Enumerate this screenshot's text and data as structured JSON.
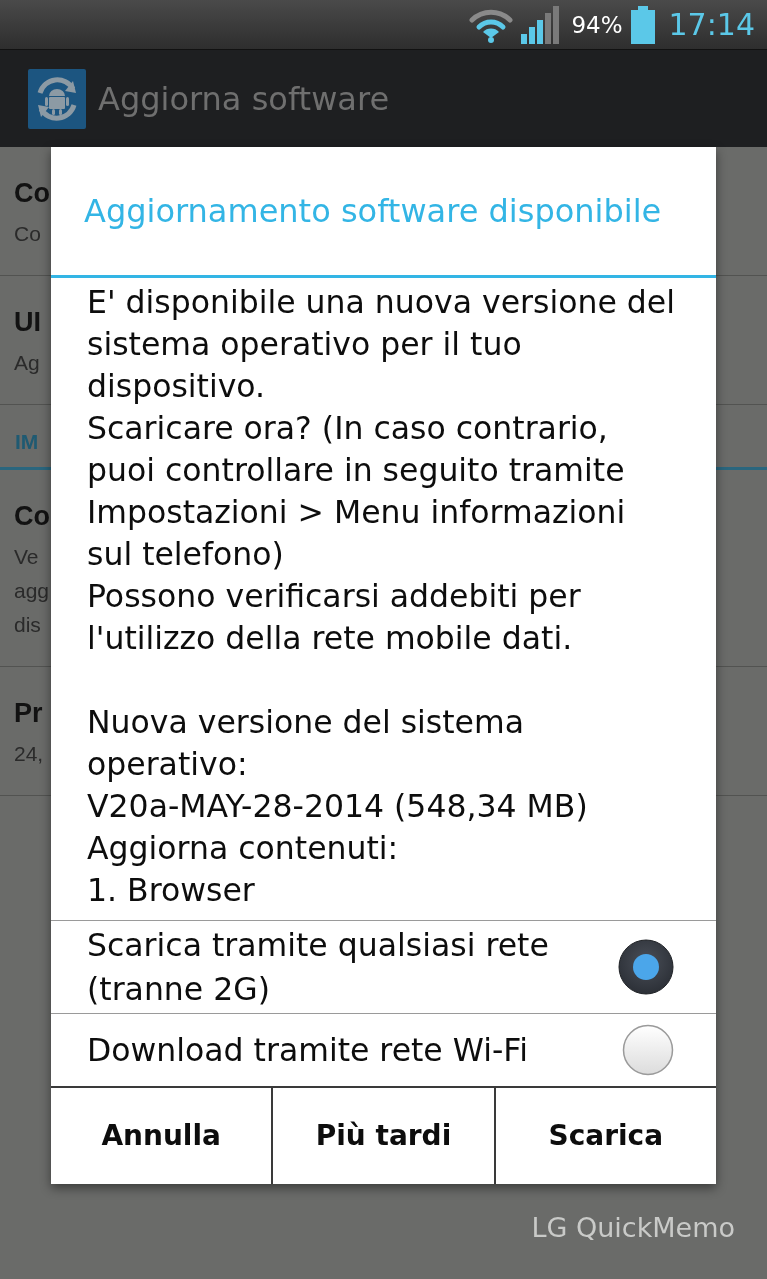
{
  "status_bar": {
    "battery": "94%",
    "time": "17:14"
  },
  "action_bar": {
    "title": "Aggiorna software"
  },
  "settings_list": [
    {
      "kind": "item",
      "title": "Co",
      "summary": [
        "Co"
      ]
    },
    {
      "kind": "item",
      "title": "UI",
      "summary": [
        "Ag"
      ]
    },
    {
      "kind": "header",
      "title": "IM"
    },
    {
      "kind": "item",
      "title": "Co",
      "summary": [
        "Ve",
        "agg",
        "dis"
      ]
    },
    {
      "kind": "item",
      "title": "Pr",
      "summary": [
        "24,"
      ]
    }
  ],
  "dialog": {
    "title": "Aggiornamento software disponibile",
    "message": [
      "E' disponibile una nuova versione del sistema operativo per il tuo dispositivo.",
      "Scaricare ora? (In caso contrario, puoi controllare in seguito tramite Impostazioni > Menu informazioni sul telefono)",
      "Possono verificarsi addebiti per l'utilizzo della rete mobile dati."
    ],
    "details": [
      "Nuova versione del sistema operativo:",
      "V20a-MAY-28-2014 (548,34 MB)",
      "Aggiorna contenuti:",
      "1. Browser"
    ],
    "options": [
      {
        "label": "Scarica tramite qualsiasi rete (tranne 2G)",
        "selected": true
      },
      {
        "label": "Download tramite rete Wi-Fi",
        "selected": false
      }
    ],
    "buttons": [
      "Annulla",
      "Più tardi",
      "Scarica"
    ]
  },
  "overlay_label": "LG QuickMemo"
}
